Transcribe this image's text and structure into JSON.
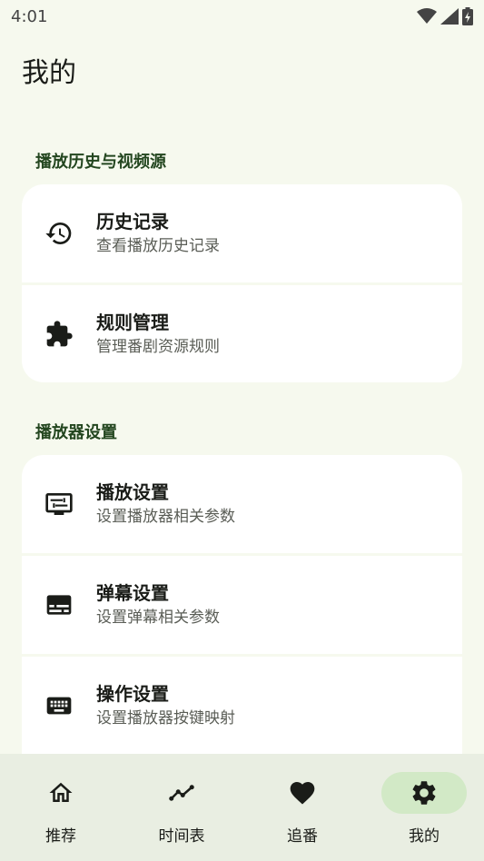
{
  "status_bar": {
    "time": "4:01"
  },
  "page": {
    "title": "我的"
  },
  "sections": [
    {
      "title": "播放历史与视频源",
      "items": [
        {
          "title": "历史记录",
          "subtitle": "查看播放历史记录",
          "icon": "history-icon"
        },
        {
          "title": "规则管理",
          "subtitle": "管理番剧资源规则",
          "icon": "puzzle-icon"
        }
      ]
    },
    {
      "title": "播放器设置",
      "items": [
        {
          "title": "播放设置",
          "subtitle": "设置播放器相关参数",
          "icon": "player-settings-icon"
        },
        {
          "title": "弹幕设置",
          "subtitle": "设置弹幕相关参数",
          "icon": "subtitles-icon"
        },
        {
          "title": "操作设置",
          "subtitle": "设置播放器按键映射",
          "icon": "keyboard-icon"
        }
      ]
    }
  ],
  "bottom_nav": {
    "items": [
      {
        "label": "推荐",
        "icon": "home-icon",
        "active": false
      },
      {
        "label": "时间表",
        "icon": "timeline-icon",
        "active": false
      },
      {
        "label": "追番",
        "icon": "heart-icon",
        "active": false
      },
      {
        "label": "我的",
        "icon": "gear-icon",
        "active": true
      }
    ]
  },
  "colors": {
    "background": "#f6f9ee",
    "card": "#ffffff",
    "section_title": "#23461f",
    "nav_background": "#e9eee2",
    "nav_active": "#d2e9c6"
  }
}
